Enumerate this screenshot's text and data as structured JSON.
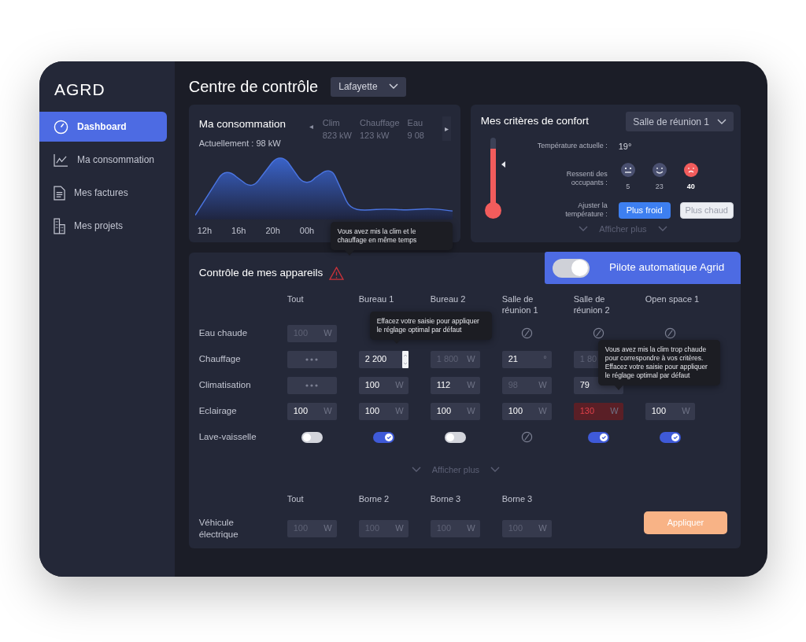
{
  "logo": "AGRD",
  "sidebar": {
    "items": [
      {
        "label": "Dashboard",
        "selected": true
      },
      {
        "label": "Ma consommation",
        "selected": false
      },
      {
        "label": "Mes factures",
        "selected": false
      },
      {
        "label": "Mes projets",
        "selected": false
      }
    ]
  },
  "header": {
    "title": "Centre de contrôle",
    "site_select": "Lafayette"
  },
  "consumption": {
    "title": "Ma consommation",
    "current": "Actuellement : 98 kW",
    "prev": "◂",
    "next": "▸",
    "carousel": [
      {
        "label": "Clim",
        "value": "823 kW"
      },
      {
        "label": "Chauffage",
        "value": "123 kW"
      },
      {
        "label": "Eau",
        "value": "9 08"
      }
    ],
    "x_labels": [
      "12h",
      "16h",
      "20h",
      "00h"
    ]
  },
  "comfort": {
    "title": "Mes critères de confort",
    "room_select": "Salle de réunion 1",
    "thermometer": {
      "level": 0.85
    },
    "temp_label": "Température actuelle :",
    "temp_value": "19°",
    "feel_label": "Ressenti des occupants :",
    "feelings": [
      {
        "kind": "cold",
        "count": "5",
        "selected": false
      },
      {
        "kind": "ok",
        "count": "23",
        "selected": false
      },
      {
        "kind": "hot",
        "count": "40",
        "selected": true
      }
    ],
    "adjust_label": "Ajuster la température :",
    "buttons": [
      {
        "label": "Plus froid",
        "selected": true
      },
      {
        "label": "Plus chaud",
        "selected": false
      }
    ],
    "more": "Afficher plus"
  },
  "devices": {
    "title": "Contrôle de mes appareils",
    "warning": true,
    "autopilot": {
      "label": "Pilote automatique Agrid",
      "on": true
    },
    "columns": [
      "Tout",
      "Bureau 1",
      "Bureau 2",
      "Salle de réunion 1",
      "Salle de réunion 2",
      "Open space 1"
    ],
    "rows": [
      {
        "label": "Eau chaude",
        "cells": [
          {
            "kind": "input",
            "placeholder": "100",
            "unit": "W"
          },
          {
            "kind": "empty"
          },
          {
            "kind": "empty"
          },
          {
            "kind": "none"
          },
          {
            "kind": "none"
          },
          {
            "kind": "none"
          }
        ]
      },
      {
        "label": "Chauffage",
        "cells": [
          {
            "kind": "dots"
          },
          {
            "kind": "input",
            "value": "2 200",
            "focused": true
          },
          {
            "kind": "input",
            "placeholder": "1 800",
            "unit": "W"
          },
          {
            "kind": "input",
            "value": "21",
            "unit": "°"
          },
          {
            "kind": "input",
            "placeholder": "1 80"
          },
          {
            "kind": "empty"
          }
        ]
      },
      {
        "label": "Climatisation",
        "cells": [
          {
            "kind": "dots"
          },
          {
            "kind": "input",
            "value": "100",
            "unit": "W"
          },
          {
            "kind": "input",
            "value": "112",
            "unit": "W"
          },
          {
            "kind": "input",
            "placeholder": "98",
            "unit": "W"
          },
          {
            "kind": "input",
            "value": "79"
          },
          {
            "kind": "empty"
          }
        ]
      },
      {
        "label": "Eclairage",
        "cells": [
          {
            "kind": "input",
            "value": "100",
            "unit": "W"
          },
          {
            "kind": "input",
            "value": "100",
            "unit": "W"
          },
          {
            "kind": "input",
            "value": "100",
            "unit": "W"
          },
          {
            "kind": "input",
            "value": "100",
            "unit": "W"
          },
          {
            "kind": "input",
            "value": "130",
            "unit": "W",
            "error": true
          },
          {
            "kind": "input",
            "value": "100",
            "unit": "W"
          }
        ]
      },
      {
        "label": "Lave-vaisselle",
        "cells": [
          {
            "kind": "toggle",
            "on": false
          },
          {
            "kind": "toggle",
            "on": true
          },
          {
            "kind": "toggle",
            "on": false
          },
          {
            "kind": "none"
          },
          {
            "kind": "toggle",
            "on": true
          },
          {
            "kind": "toggle",
            "on": true
          }
        ]
      }
    ],
    "more": "Afficher plus",
    "ev_columns": [
      "Tout",
      "Borne 2",
      "Borne 3",
      "Borne 3"
    ],
    "ev_label": "Véhicule électrique",
    "ev_cells": [
      {
        "placeholder": "100",
        "unit": "W"
      },
      {
        "placeholder": "100",
        "unit": "W"
      },
      {
        "placeholder": "100",
        "unit": "W"
      },
      {
        "placeholder": "100",
        "unit": "W"
      }
    ],
    "apply": "Appliquer"
  },
  "tooltips": [
    {
      "text": "Vous avez mis la clim et le chauffage en même temps"
    },
    {
      "text": "Effacez votre saisie pour appliquer le réglage optimal par défaut"
    },
    {
      "text": "Vous avez mis la clim trop chaude pour correspondre à vos critères. Effacez votre saisie pour appliquer le réglage optimal par défaut"
    }
  ]
}
